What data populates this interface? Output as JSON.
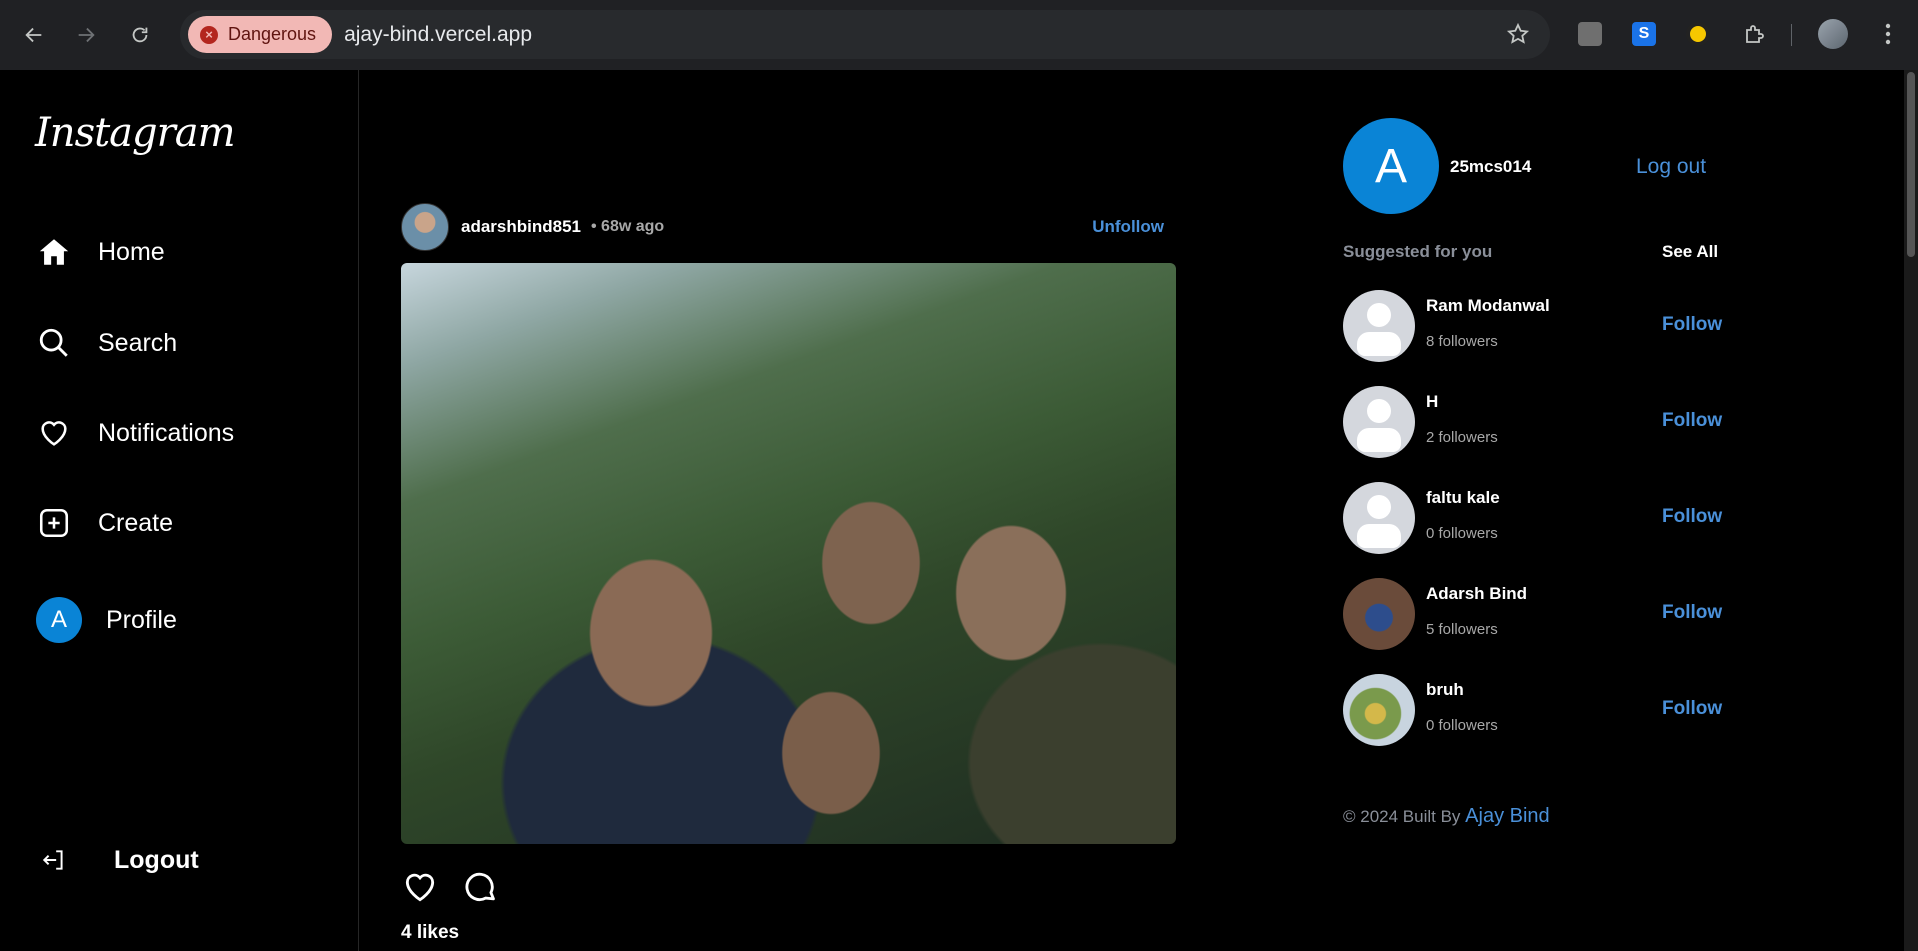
{
  "browser": {
    "security_label": "Dangerous",
    "url": "ajay-bind.vercel.app",
    "back_icon": "arrow-left-icon",
    "forward_icon": "arrow-right-icon",
    "reload_icon": "reload-icon",
    "bookmark_icon": "star-icon",
    "extensions": [
      "extension-gray-icon",
      "extension-blue-icon",
      "extension-target-icon",
      "puzzle-icon"
    ]
  },
  "sidebar": {
    "logo": "Instagram",
    "items": [
      {
        "label": "Home",
        "icon": "home-icon"
      },
      {
        "label": "Search",
        "icon": "search-icon"
      },
      {
        "label": "Notifications",
        "icon": "heart-icon"
      },
      {
        "label": "Create",
        "icon": "plus-square-icon"
      },
      {
        "label": "Profile",
        "icon": "avatar",
        "avatar_letter": "A"
      }
    ],
    "logout_label": "Logout"
  },
  "post": {
    "username": "adarshbind851",
    "time": "• 68w ago",
    "unfollow_label": "Unfollow",
    "likes": "4 likes"
  },
  "me": {
    "avatar_letter": "A",
    "username": "25mcs014",
    "logout_label": "Log out"
  },
  "suggestions": {
    "title": "Suggested for you",
    "see_all": "See All",
    "follow_label": "Follow",
    "items": [
      {
        "name": "Ram Modanwal",
        "followers": "8 followers"
      },
      {
        "name": "H",
        "followers": "2 followers"
      },
      {
        "name": "faltu kale",
        "followers": "0 followers"
      },
      {
        "name": "Adarsh Bind",
        "followers": "5 followers"
      },
      {
        "name": "bruh",
        "followers": "0 followers"
      }
    ]
  },
  "footer": {
    "prefix": "© 2024 Built By",
    "author": "Ajay Bind"
  },
  "colors": {
    "accent": "#4a90d9",
    "avatar_blue": "#0a84d6",
    "danger_chip": "#f2b8b5"
  }
}
